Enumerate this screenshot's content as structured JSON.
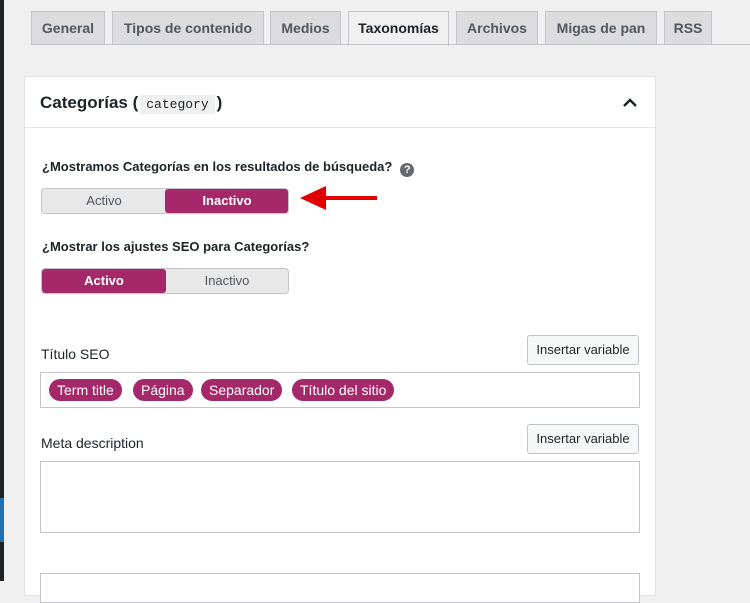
{
  "tabs": [
    {
      "label": "General",
      "active": false
    },
    {
      "label": "Tipos de contenido",
      "active": false
    },
    {
      "label": "Medios",
      "active": false
    },
    {
      "label": "Taxonomías",
      "active": true
    },
    {
      "label": "Archivos",
      "active": false
    },
    {
      "label": "Migas de pan",
      "active": false
    },
    {
      "label": "RSS",
      "active": false
    }
  ],
  "panel": {
    "title_prefix": "Categorías (",
    "title_code": "category",
    "title_suffix": ")",
    "chevron_icon": "chevron-up-icon"
  },
  "search_visibility": {
    "question": "¿Mostramos Categorías en los resultados de búsqueda?",
    "help_icon": "help-icon",
    "help_glyph": "?",
    "options": [
      "Activo",
      "Inactivo"
    ],
    "selected": "Inactivo"
  },
  "annotation": {
    "icon": "red-arrow-icon",
    "color": "#e00000"
  },
  "seo_settings": {
    "question": "¿Mostrar los ajustes SEO para Categorías?",
    "options": [
      "Activo",
      "Inactivo"
    ],
    "selected": "Activo"
  },
  "seo_title": {
    "label": "Título SEO",
    "insert_button": "Insertar variable",
    "tags": [
      "Term title",
      "Página",
      "Separador",
      "Título del sitio"
    ]
  },
  "meta_description": {
    "label": "Meta description",
    "insert_button": "Insertar variable",
    "value": ""
  },
  "colors": {
    "accent": "#a4286a",
    "background": "#f0f0f1",
    "panel": "#ffffff"
  }
}
